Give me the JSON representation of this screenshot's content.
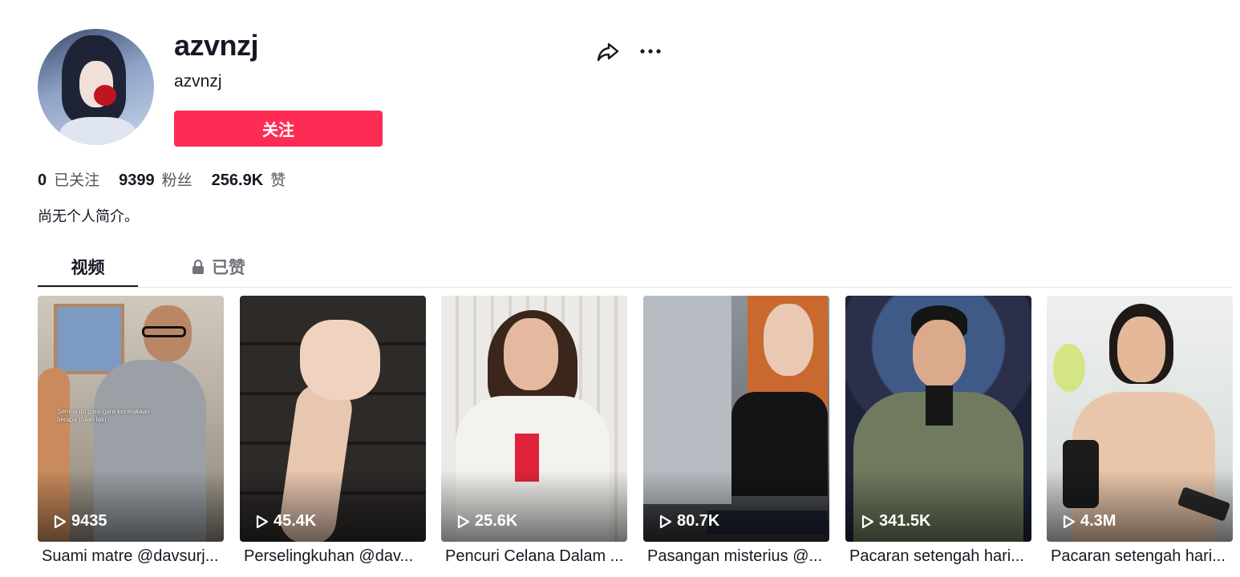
{
  "profile": {
    "username": "azvnzj",
    "nickname": "azvnzj",
    "follow_label": "关注"
  },
  "stats": [
    {
      "value": "0",
      "label": "已关注"
    },
    {
      "value": "9399",
      "label": "粉丝"
    },
    {
      "value": "256.9K",
      "label": "赞"
    }
  ],
  "bio": "尚无个人简介。",
  "tabs": [
    {
      "label": "视频",
      "active": true
    },
    {
      "label": "已赞",
      "locked": true
    }
  ],
  "icons": {
    "share": "share-icon",
    "more": "more-icon",
    "lock": "lock-icon",
    "play": "play-icon"
  },
  "colors": {
    "accent": "#fe2c55",
    "text": "#161823"
  },
  "videos": [
    {
      "views": "9435",
      "caption": "Suami matre @davsurj...",
      "subtitle": "Semua itu gara-gara kecelakaan berapa bulan lalu"
    },
    {
      "views": "45.4K",
      "caption": "Perselingkuhan @dav..."
    },
    {
      "views": "25.6K",
      "caption": "Pencuri Celana Dalam ..."
    },
    {
      "views": "80.7K",
      "caption": "Pasangan misterius @..."
    },
    {
      "views": "341.5K",
      "caption": "Pacaran setengah hari..."
    },
    {
      "views": "4.3M",
      "caption": "Pacaran setengah hari..."
    }
  ]
}
